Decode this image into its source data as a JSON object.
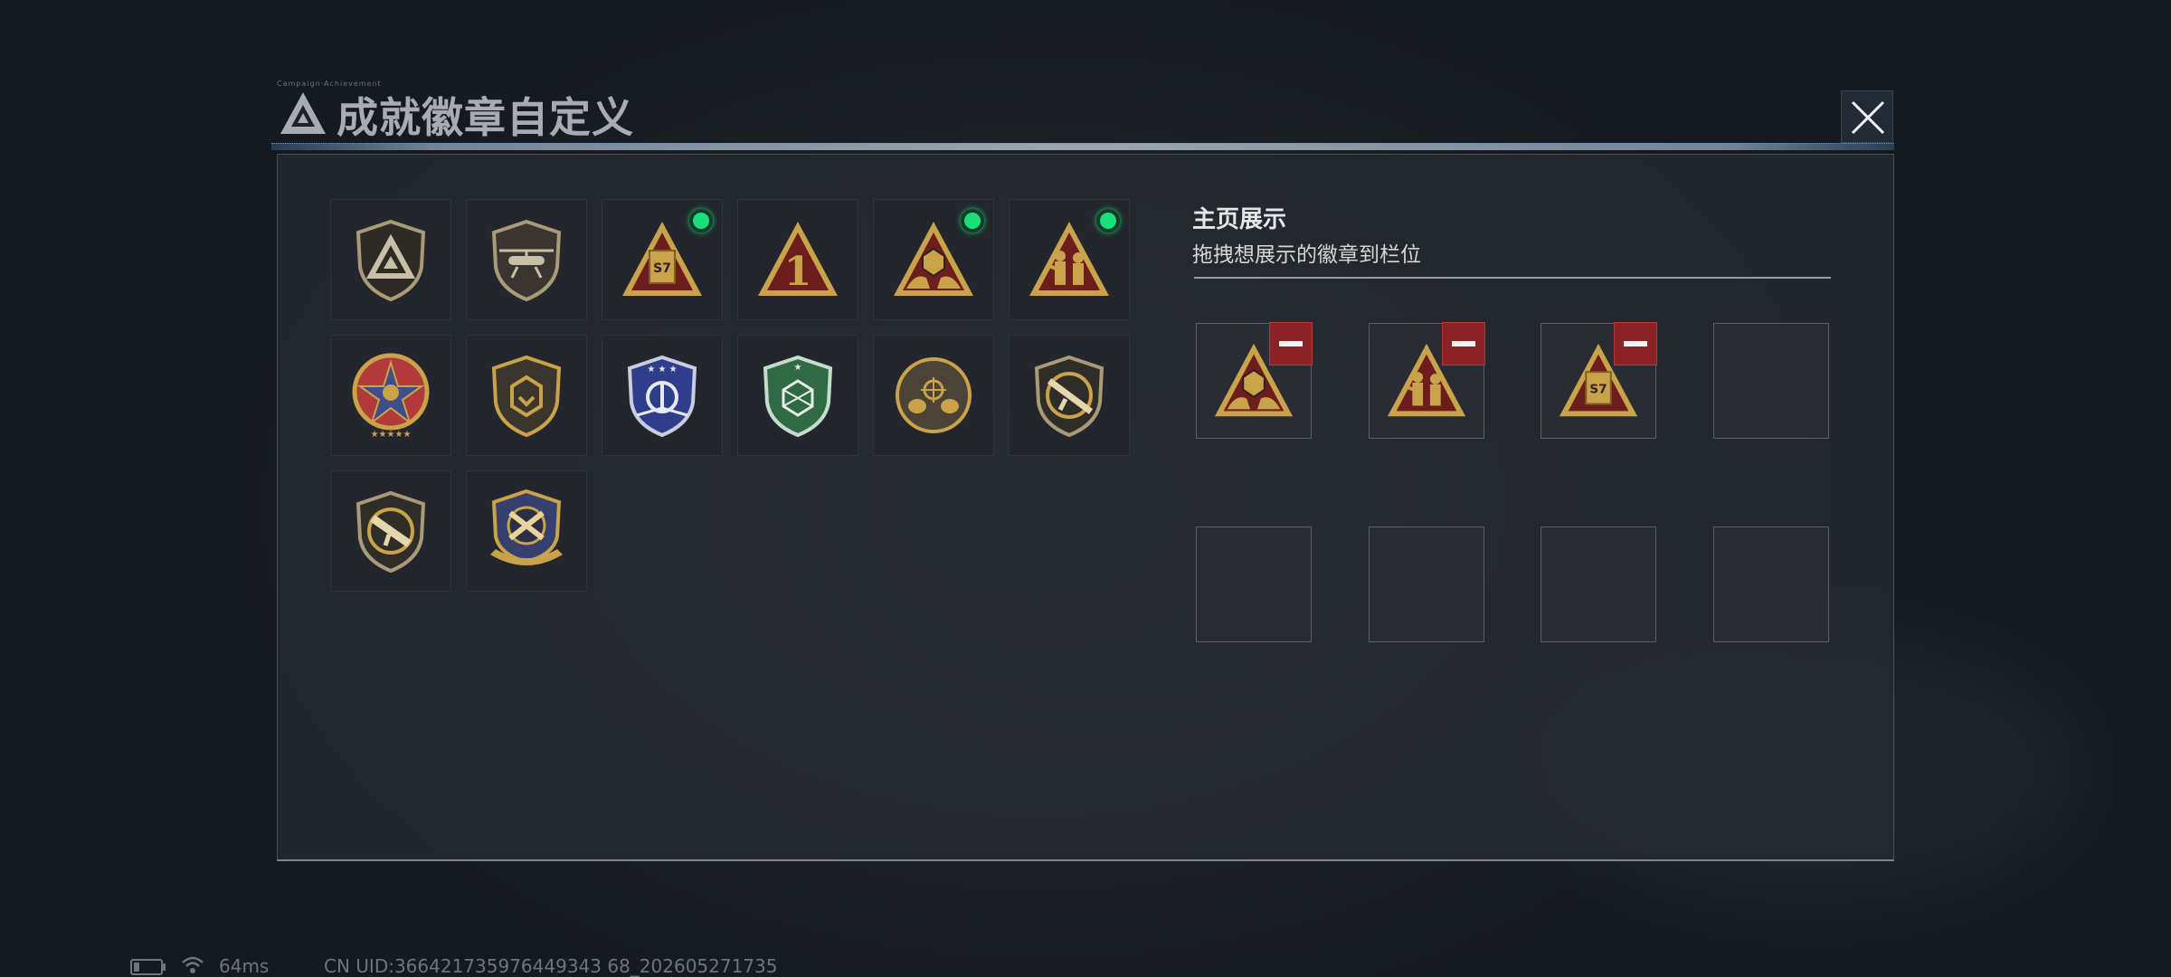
{
  "dialog": {
    "title": "成就徽章自定义",
    "tiny_caption": "Campaign·Achievement"
  },
  "badges": [
    {
      "icon": "triangle-logo-shield-badge-icon",
      "equipped": false
    },
    {
      "icon": "helicopter-shield-badge-icon",
      "equipped": false
    },
    {
      "icon": "s7-card-triangle-badge-icon",
      "equipped": true
    },
    {
      "icon": "number-one-triangle-badge-icon",
      "equipped": false
    },
    {
      "icon": "hands-d20-triangle-badge-icon",
      "equipped": true
    },
    {
      "icon": "soldiers-triangle-badge-icon",
      "equipped": true
    },
    {
      "icon": "star-medal-badge-icon",
      "equipped": false
    },
    {
      "icon": "gold-crest-shield-badge-icon",
      "equipped": false
    },
    {
      "icon": "blue-wings-shield-badge-icon",
      "equipped": false
    },
    {
      "icon": "green-d20-shield-badge-icon",
      "equipped": false
    },
    {
      "icon": "helmet-crosshair-round-badge-icon",
      "equipped": false
    },
    {
      "icon": "rifle-shield-badge-icon",
      "equipped": false
    },
    {
      "icon": "smg-shield-badge-icon",
      "equipped": false
    },
    {
      "icon": "crossed-guns-winged-badge-icon",
      "equipped": false
    }
  ],
  "showcase": {
    "title": "主页展示",
    "subtitle": "拖拽想展示的徽章到栏位",
    "slots": [
      {
        "badge": "hands-d20-triangle-badge-icon",
        "filled": true
      },
      {
        "badge": "soldiers-triangle-badge-icon",
        "filled": true
      },
      {
        "badge": "s7-card-triangle-badge-icon",
        "filled": true
      },
      {
        "badge": "",
        "filled": false
      },
      {
        "badge": "",
        "filled": false
      },
      {
        "badge": "",
        "filled": false
      },
      {
        "badge": "",
        "filled": false
      },
      {
        "badge": "",
        "filled": false
      }
    ]
  },
  "footer": {
    "ping": "64ms",
    "uid": "CN UID:366421735976449343 68_202605271735"
  },
  "colors": {
    "accent_green": "#19e07a",
    "remove_red": "#8b2226",
    "gold": "#c9a24a"
  }
}
